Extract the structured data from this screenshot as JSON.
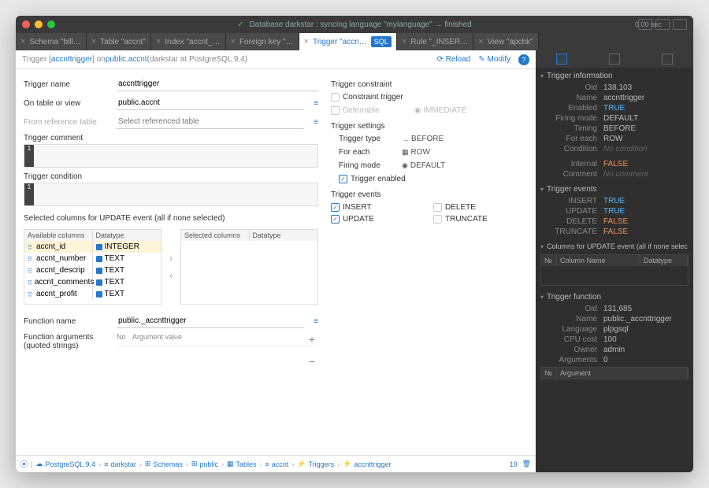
{
  "title": {
    "status": "Database darkstar : syncing language \"mylanguage\" → finished",
    "time": "0.00 sec"
  },
  "tabs": [
    {
      "label": "Schema \"bill…"
    },
    {
      "label": "Table \"accnt\""
    },
    {
      "label": "Index \"accnt_…"
    },
    {
      "label": "Foreign key \"…"
    },
    {
      "label": "Trigger \"accn…",
      "active": true
    },
    {
      "label": "Rule \"_INSER…"
    },
    {
      "label": "View \"apchk\""
    }
  ],
  "header": {
    "prefix": "Trigger [ ",
    "name": "accnttrigger",
    "mid": " ] on ",
    "table": "public.accnt",
    "ctx": " (darkstar at PostgreSQL 9.4)",
    "reload": "Reload",
    "modify": "Modify"
  },
  "left": {
    "trigger_name_l": "Trigger name",
    "trigger_name_v": "accnttrigger",
    "on_table_l": "On table or view",
    "on_table_v": "public.accnt",
    "from_ref_l": "From reference table",
    "from_ref_ph": "Select referenced table",
    "comment_l": "Trigger comment",
    "condition_l": "Trigger condition",
    "sel_cols_l": "Selected columns for UPDATE event (all if none selected)",
    "avail_hdr": "Available columns",
    "dtype_hdr": "Datatype",
    "sel_hdr": "Selected columns",
    "cols": [
      {
        "n": "accnt_id",
        "t": "INTEGER",
        "sel": true
      },
      {
        "n": "accnt_number",
        "t": "TEXT"
      },
      {
        "n": "accnt_descrip",
        "t": "TEXT"
      },
      {
        "n": "accnt_comments",
        "t": "TEXT"
      },
      {
        "n": "accnt_profit",
        "t": "TEXT"
      }
    ],
    "fn_name_l": "Function name",
    "fn_name_v": "public._accnttrigger",
    "fn_args_l": "Function arguments (quoted strings)",
    "fn_args_hdr_no": "No",
    "fn_args_hdr_val": "Argument value"
  },
  "right": {
    "constraint_hdr": "Trigger constraint",
    "constraint_trigger": "Constraint trigger",
    "deferrable": "Deferrable",
    "immediate": "IMMEDIATE",
    "settings_hdr": "Trigger settings",
    "type_l": "Trigger type",
    "type_v": "BEFORE",
    "foreach_l": "For each",
    "foreach_v": "ROW",
    "firing_l": "Firing mode",
    "firing_v": "DEFAULT",
    "enabled": "Trigger enabled",
    "events_hdr": "Trigger events",
    "insert": "INSERT",
    "delete": "DELETE",
    "update": "UPDATE",
    "truncate": "TRUNCATE"
  },
  "crumbs": [
    "PostgreSQL 9.4",
    "darkstar",
    "Schemas",
    "public",
    "Tables",
    "accnt",
    "Triggers",
    "accnttrigger"
  ],
  "crumb_end": "19",
  "side": {
    "info_hdr": "Trigger information",
    "info": [
      {
        "k": "Oid",
        "v": "138,103"
      },
      {
        "k": "Name",
        "v": "accnttrigger"
      },
      {
        "k": "Enabled",
        "v": "TRUE",
        "c": "blue"
      },
      {
        "k": "Firing mode",
        "v": "DEFAULT"
      },
      {
        "k": "Timing",
        "v": "BEFORE"
      },
      {
        "k": "For each",
        "v": "ROW"
      },
      {
        "k": "Condition",
        "v": "No condition",
        "c": "muted"
      },
      {
        "k": "",
        "v": ""
      },
      {
        "k": "Internal",
        "v": "FALSE",
        "c": "orange"
      },
      {
        "k": "Comment",
        "v": "No comment",
        "c": "muted"
      }
    ],
    "events_hdr": "Trigger events",
    "events": [
      {
        "k": "INSERT",
        "v": "TRUE",
        "c": "blue"
      },
      {
        "k": "UPDATE",
        "v": "TRUE",
        "c": "blue"
      },
      {
        "k": "DELETE",
        "v": "FALSE",
        "c": "orange"
      },
      {
        "k": "TRUNCATE",
        "v": "FALSE",
        "c": "orange"
      }
    ],
    "cols_hdr": "Columns for UPDATE event (all if none selec",
    "cols_th": [
      "№",
      "Column Name",
      "Datatype"
    ],
    "fn_hdr": "Trigger function",
    "fn": [
      {
        "k": "Oid",
        "v": "131,685"
      },
      {
        "k": "Name",
        "v": "public._accnttrigger"
      },
      {
        "k": "Language",
        "v": "plpgsql"
      },
      {
        "k": "CPU cost",
        "v": "100"
      },
      {
        "k": "Owner",
        "v": "admin"
      },
      {
        "k": "Arguments",
        "v": "0"
      }
    ],
    "arg_th": [
      "№",
      "Argument"
    ]
  }
}
